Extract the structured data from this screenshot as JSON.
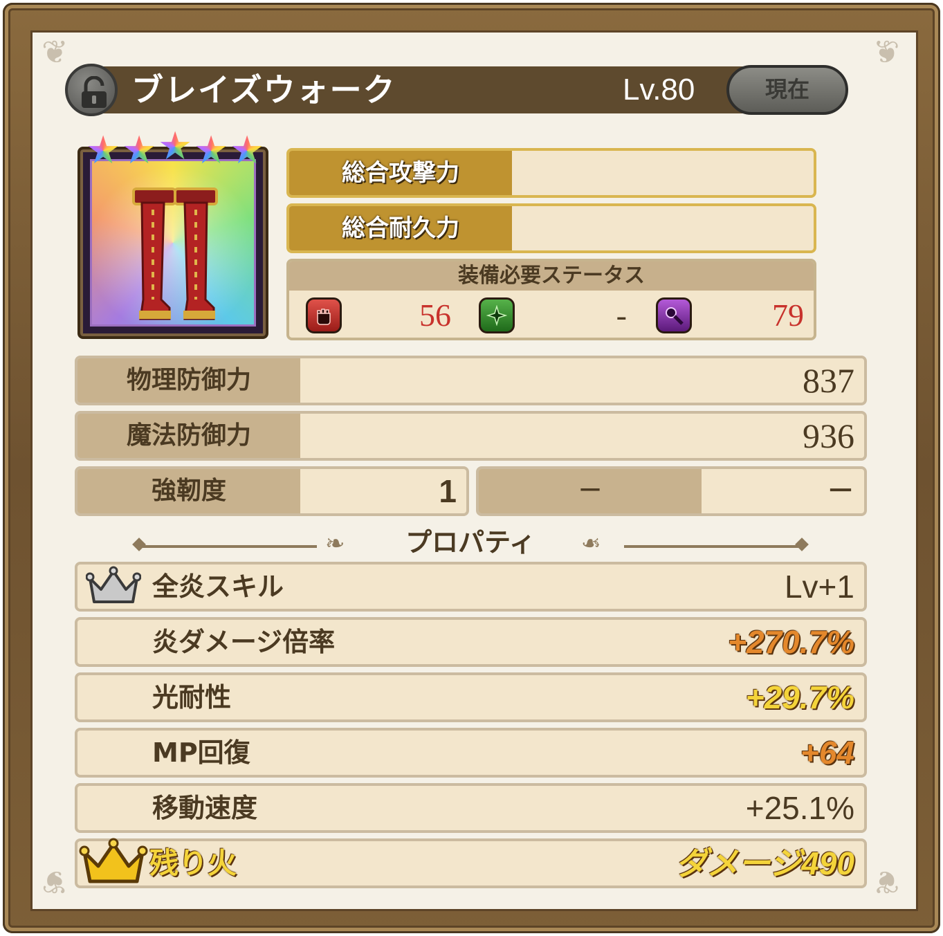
{
  "item": {
    "name": "ブレイズウォーク",
    "level": "Lv.80",
    "current_label": "現在",
    "rarity_stars": 5
  },
  "totals": {
    "attack_label": "総合攻撃力",
    "durability_label": "総合耐久力"
  },
  "required_status": {
    "title": "装備必要ステータス",
    "entries": [
      {
        "icon": "fist-icon",
        "value": "56",
        "color": "#c8322c"
      },
      {
        "icon": "sparkle-icon",
        "value": "-",
        "color": "#3a7a2a"
      },
      {
        "icon": "magic-wand-icon",
        "value": "79",
        "color": "#8b2fae"
      }
    ]
  },
  "stats": {
    "phys_def_label": "物理防御力",
    "phys_def_value": "837",
    "mag_def_label": "魔法防御力",
    "mag_def_value": "936",
    "toughness_label": "強靭度",
    "toughness_value": "1",
    "extra_label": "－",
    "extra_value": "－"
  },
  "properties": {
    "title": "プロパティ",
    "rows": [
      {
        "name": "全炎スキル",
        "value": "Lv+1",
        "style": "plain",
        "icon": "silver-crown-icon"
      },
      {
        "name": "炎ダメージ倍率",
        "value": "+270.7%",
        "style": "orange"
      },
      {
        "name": "光耐性",
        "value": "+29.7%",
        "style": "yellow"
      },
      {
        "name": "MP回復",
        "value": "+64",
        "style": "orange"
      },
      {
        "name": "移動速度",
        "value": "+25.1%",
        "style": "plain"
      }
    ],
    "special": {
      "name": "残り火",
      "value": "ダメージ490",
      "icon": "gold-crown-icon"
    }
  },
  "colors": {
    "frame": "#6e5230",
    "panel": "#f5f1e7",
    "gold_label": "#bf9330",
    "label_bg": "#c8b28e",
    "text": "#4b3a22"
  }
}
